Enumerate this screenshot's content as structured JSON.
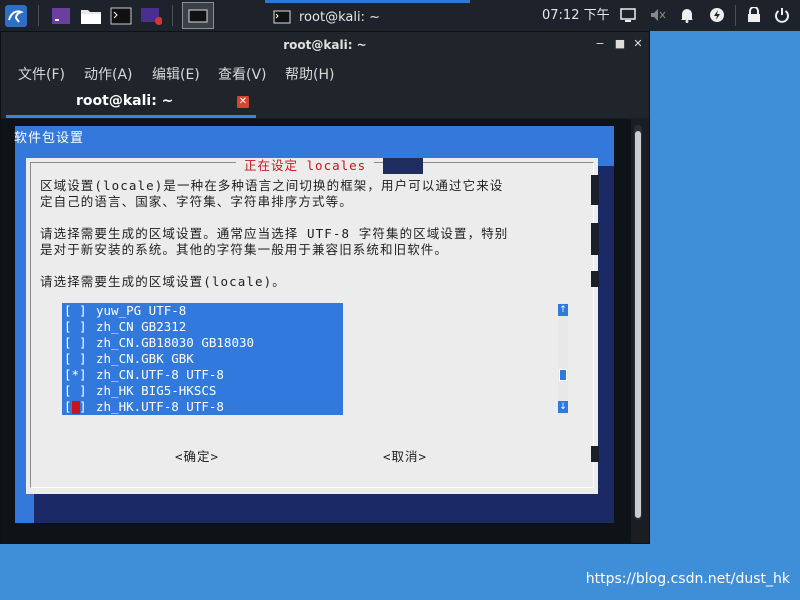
{
  "taskbar": {
    "window_title": "root@kali: ~",
    "clock": "07:12 下午"
  },
  "window": {
    "title": "root@kali: ~",
    "menu": [
      "文件(F)",
      "动作(A)",
      "编辑(E)",
      "查看(V)",
      "帮助(H)"
    ],
    "tab_label": "root@kali: ~"
  },
  "terminal": {
    "background_title": "软件包设置",
    "dialog": {
      "title": "正在设定 locales",
      "paragraph1_line1": "区域设置(locale)是一种在多种语言之间切换的框架，用户可以通过它来设",
      "paragraph1_line2": "定自己的语言、国家、字符集、字符串排序方式等。",
      "paragraph2_line1": "请选择需要生成的区域设置。通常应当选择 UTF-8 字符集的区域设置，特别",
      "paragraph2_line2": "是对于新安装的系统。其他的字符集一般用于兼容旧系统和旧软件。",
      "prompt": "请选择需要生成的区域设置(locale)。",
      "locales": [
        {
          "check": "[ ]",
          "label": "yuw_PG UTF-8"
        },
        {
          "check": "[ ]",
          "label": "zh_CN GB2312"
        },
        {
          "check": "[ ]",
          "label": "zh_CN.GB18030 GB18030"
        },
        {
          "check": "[ ]",
          "label": "zh_CN.GBK GBK"
        },
        {
          "check": "[*]",
          "label": "zh_CN.UTF-8 UTF-8"
        },
        {
          "check": "[ ]",
          "label": "zh_HK BIG5-HKSCS"
        },
        {
          "check": "[ ]",
          "label": "zh_HK.UTF-8 UTF-8"
        }
      ],
      "ok_button": "<确定>",
      "cancel_button": "<取消>"
    }
  },
  "watermark": "https://blog.csdn.net/dust_hk",
  "colors": {
    "desktop": "#3f8fd8",
    "dialog_blue": "#3279de",
    "accent_red": "#c8141e",
    "terminal_bg": "#0e1318"
  }
}
